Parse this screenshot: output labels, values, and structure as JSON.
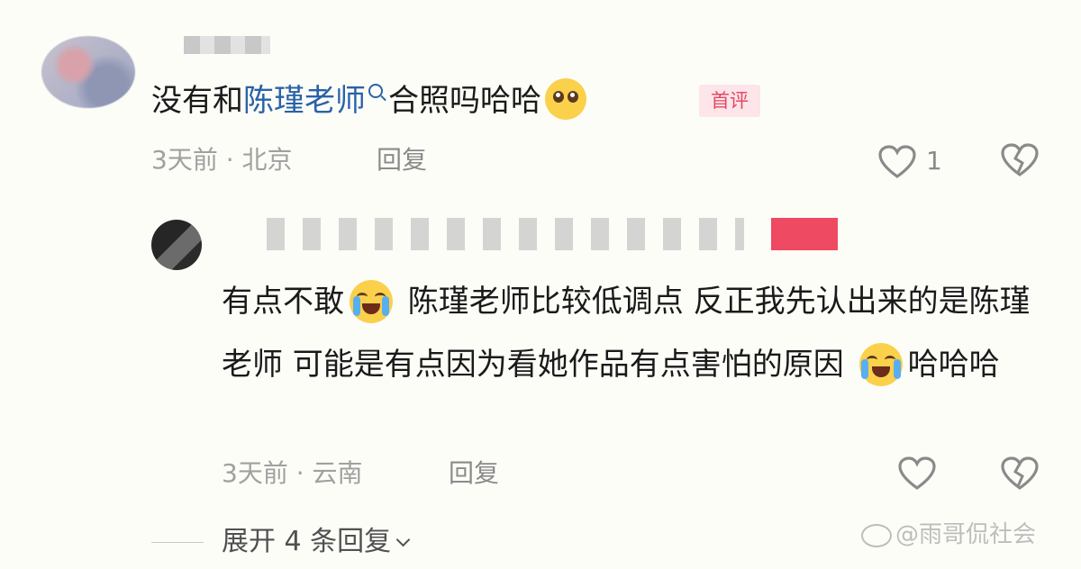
{
  "comment1": {
    "text_before_link": "没有和",
    "link_text": "陈瑾老师",
    "text_after_link": "合照吗哈哈",
    "emoji": "pleading-hands-emoji",
    "badge": "首评",
    "meta": "3天前 · 北京",
    "reply_label": "回复",
    "like_count": "1"
  },
  "comment2": {
    "segments": [
      "有点不敢",
      " 陈瑾老师比较低调点 反正我先认出来的是陈瑾老师 可能是有点因为看她作品有点害怕的原因 ",
      "哈哈哈"
    ],
    "meta": "3天前 · 云南",
    "reply_label": "回复"
  },
  "expand_label": "展开 4 条回复",
  "watermark": "@雨哥侃社会",
  "colors": {
    "link": "#2a62a8",
    "badge_text": "#e14a66",
    "badge_bg": "#fde5e9",
    "name_tag": "#ee4a62"
  },
  "icons": [
    "heart-outline-icon",
    "broken-heart-icon",
    "chevron-down-icon",
    "search-icon"
  ]
}
